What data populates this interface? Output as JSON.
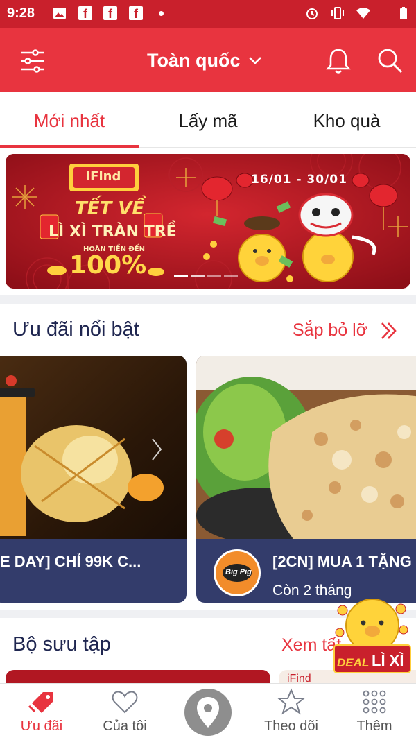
{
  "status_bar": {
    "time": "9:28",
    "notification_icons": [
      "image-icon",
      "facebook-icon",
      "facebook-icon",
      "facebook-icon",
      "dot-icon"
    ],
    "system_icons": [
      "alarm-icon",
      "vibrate-icon",
      "wifi-icon",
      "battery-icon"
    ]
  },
  "header": {
    "location": "Toàn quốc",
    "menu_icon": "sliders-icon",
    "notification_icon": "bell-icon",
    "search_icon": "search-icon"
  },
  "tabs": [
    {
      "label": "Mới nhất",
      "active": true
    },
    {
      "label": "Lấy mã",
      "active": false
    },
    {
      "label": "Kho quà",
      "active": false
    }
  ],
  "banner": {
    "brand": "iFind",
    "headline": "TẾT VỀ",
    "subheadline": "LÌ XÌ TRÀN TRỀ",
    "cashback_label": "HOÀN TIỀN ĐẾN",
    "cashback_value": "100%",
    "date_range": "16/01 - 30/01"
  },
  "featured": {
    "title": "Ưu đãi nổi bật",
    "link": "Sắp bỏ lỡ",
    "cards": [
      {
        "title": "E DAY] CHỈ 99K C...",
        "subtitle": ""
      },
      {
        "title": "[2CN] MUA 1 TẶNG",
        "subtitle": "Còn 2 tháng",
        "logo": "Big Pig"
      }
    ]
  },
  "collection": {
    "title": "Bộ sưu tập",
    "link": "Xem tất",
    "peek_brand": "iFind"
  },
  "floating_badge": {
    "text_1": "DEAL",
    "text_2": "LÌ XÌ"
  },
  "bottom_nav": [
    {
      "label": "Ưu đãi",
      "icon": "tag-icon",
      "active": true
    },
    {
      "label": "Của tôi",
      "icon": "heart-icon",
      "active": false
    },
    {
      "label": "",
      "icon": "map-pin-icon",
      "active": false
    },
    {
      "label": "Theo dõi",
      "icon": "star-icon",
      "active": false
    },
    {
      "label": "Thêm",
      "icon": "grid-icon",
      "active": false
    }
  ],
  "colors": {
    "primary_red": "#e8343f",
    "status_red": "#c9202c",
    "navy_text": "#1f2650",
    "card_footer": "#333c6b"
  }
}
